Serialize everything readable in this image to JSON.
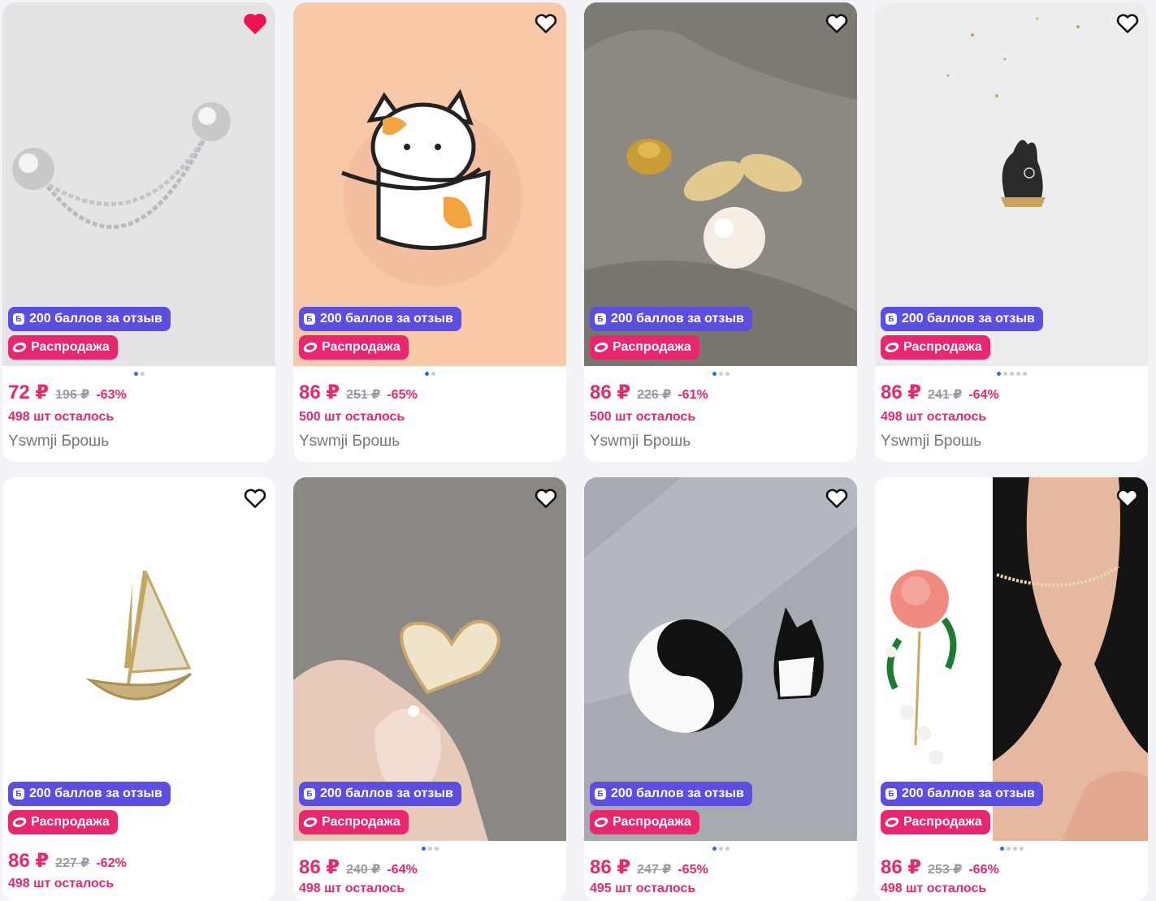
{
  "products": [
    {
      "reward": "200 баллов за отзыв",
      "sale": "Распродажа",
      "price": "72 ₽",
      "old_price": "196 ₽",
      "discount": "-63%",
      "stock": "498 шт осталось",
      "name": "Yswmji Брошь",
      "favorited": true,
      "image_pages": 2,
      "image_page_active": 1,
      "image_icon": "silver-chain-collar-brooch"
    },
    {
      "reward": "200 баллов за отзыв",
      "sale": "Распродажа",
      "price": "86 ₽",
      "old_price": "251 ₽",
      "discount": "-65%",
      "stock": "500 шт осталось",
      "name": "Yswmji Брошь",
      "favorited": false,
      "image_pages": 2,
      "image_page_active": 1,
      "image_icon": "cat-in-bowl-pin"
    },
    {
      "reward": "200 баллов за отзыв",
      "sale": "Распродажа",
      "price": "86 ₽",
      "old_price": "226 ₽",
      "discount": "-61%",
      "stock": "500 шт осталось",
      "name": "Yswmji Брошь",
      "favorited": false,
      "image_pages": 3,
      "image_page_active": 1,
      "image_icon": "pearl-bee-brooch"
    },
    {
      "reward": "200 баллов за отзыв",
      "sale": "Распродажа",
      "price": "86 ₽",
      "old_price": "241 ₽",
      "discount": "-64%",
      "stock": "498 шт осталось",
      "name": "Yswmji Брошь",
      "favorited": false,
      "image_pages": 5,
      "image_page_active": 1,
      "image_icon": "filigree-cat-brooch"
    },
    {
      "reward": "200 баллов за отзыв",
      "sale": "Распродажа",
      "price": "86 ₽",
      "old_price": "227 ₽",
      "discount": "-62%",
      "stock": "498 шт осталось",
      "name": "",
      "favorited": false,
      "image_pages": 0,
      "image_page_active": 0,
      "image_icon": "sailboat-brooch"
    },
    {
      "reward": "200 баллов за отзыв",
      "sale": "Распродажа",
      "price": "86 ₽",
      "old_price": "240 ₽",
      "discount": "-64%",
      "stock": "498 шт осталось",
      "name": "",
      "favorited": false,
      "image_pages": 3,
      "image_page_active": 1,
      "image_icon": "crystal-heart-brooch"
    },
    {
      "reward": "200 баллов за отзыв",
      "sale": "Распродажа",
      "price": "86 ₽",
      "old_price": "247 ₽",
      "discount": "-65%",
      "stock": "495 шт осталось",
      "name": "",
      "favorited": false,
      "image_pages": 3,
      "image_page_active": 1,
      "image_icon": "yin-yang-cats-pins"
    },
    {
      "reward": "200 баллов за отзыв",
      "sale": "Распродажа",
      "price": "86 ₽",
      "old_price": "253 ₽",
      "discount": "-66%",
      "stock": "498 шт осталось",
      "name": "",
      "favorited": false,
      "image_pages": 4,
      "image_page_active": 1,
      "image_icon": "rose-pearl-brooch"
    }
  ],
  "colors": {
    "accent": "#e8276f",
    "reward": "#5d4ee2",
    "old_price": "#9a9aa6",
    "name": "#757582",
    "dot_active": "#2b6bf3"
  }
}
